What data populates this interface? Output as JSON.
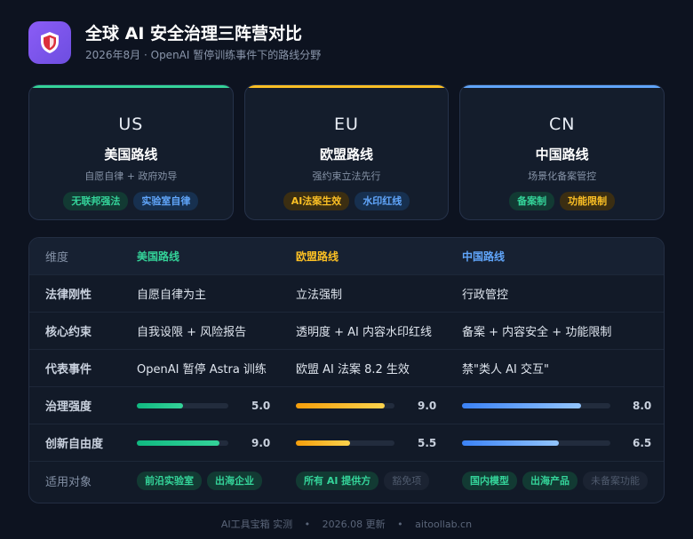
{
  "header": {
    "title": "全球 AI 安全治理三阵营对比",
    "subtitle": "2026年8月 · OpenAI 暂停训练事件下的路线分野",
    "logo_icon": "shield-icon"
  },
  "colors": {
    "us": "#34d399",
    "eu": "#fbbf24",
    "cn": "#60a5fa"
  },
  "cards": [
    {
      "code": "US",
      "name": "美国路线",
      "desc": "自愿自律 + 政府劝导",
      "color": "#34d399",
      "tags": [
        {
          "label": "无联邦强法",
          "tone": "green"
        },
        {
          "label": "实验室自律",
          "tone": "blue"
        }
      ]
    },
    {
      "code": "EU",
      "name": "欧盟路线",
      "desc": "强约束立法先行",
      "color": "#fbbf24",
      "tags": [
        {
          "label": "AI法案生效",
          "tone": "amber"
        },
        {
          "label": "水印红线",
          "tone": "blue"
        }
      ]
    },
    {
      "code": "CN",
      "name": "中国路线",
      "desc": "场景化备案管控",
      "color": "#60a5fa",
      "tags": [
        {
          "label": "备案制",
          "tone": "green"
        },
        {
          "label": "功能限制",
          "tone": "amber"
        }
      ]
    }
  ],
  "table": {
    "headers": {
      "dim": "维度",
      "us": "美国路线",
      "eu": "欧盟路线",
      "cn": "中国路线"
    },
    "rows": [
      {
        "dim": "法律刚性",
        "us": "自愿自律为主",
        "eu": "立法强制",
        "cn": "行政管控"
      },
      {
        "dim": "核心约束",
        "us": "自我设限 + 风险报告",
        "eu": "透明度 + AI 内容水印红线",
        "cn": "备案 + 内容安全 + 功能限制"
      },
      {
        "dim": "代表事件",
        "us": "OpenAI 暂停 Astra 训练",
        "eu": "欧盟 AI 法案 8.2 生效",
        "cn": "禁\"类人 AI 交互\""
      }
    ],
    "meters": [
      {
        "dim": "治理强度",
        "us": {
          "value": 5.0,
          "label": "5.0"
        },
        "eu": {
          "value": 9.0,
          "label": "9.0"
        },
        "cn": {
          "value": 8.0,
          "label": "8.0"
        }
      },
      {
        "dim": "创新自由度",
        "us": {
          "value": 9.0,
          "label": "9.0"
        },
        "eu": {
          "value": 5.5,
          "label": "5.5"
        },
        "cn": {
          "value": 6.5,
          "label": "6.5"
        }
      }
    ],
    "meter_max": 10,
    "targets": {
      "dim": "适用对象",
      "us": [
        {
          "label": "前沿实验室",
          "tone": "green"
        },
        {
          "label": "出海企业",
          "tone": "green"
        }
      ],
      "eu": [
        {
          "label": "所有 AI 提供方",
          "tone": "green"
        },
        {
          "label": "豁免项",
          "tone": "gray"
        }
      ],
      "cn": [
        {
          "label": "国内模型",
          "tone": "green"
        },
        {
          "label": "出海产品",
          "tone": "green"
        },
        {
          "label": "未备案功能",
          "tone": "gray"
        }
      ]
    }
  },
  "footer": {
    "source": "AI工具宝箱 实测",
    "date": "2026.08 更新",
    "site": "aitoollab.cn"
  }
}
